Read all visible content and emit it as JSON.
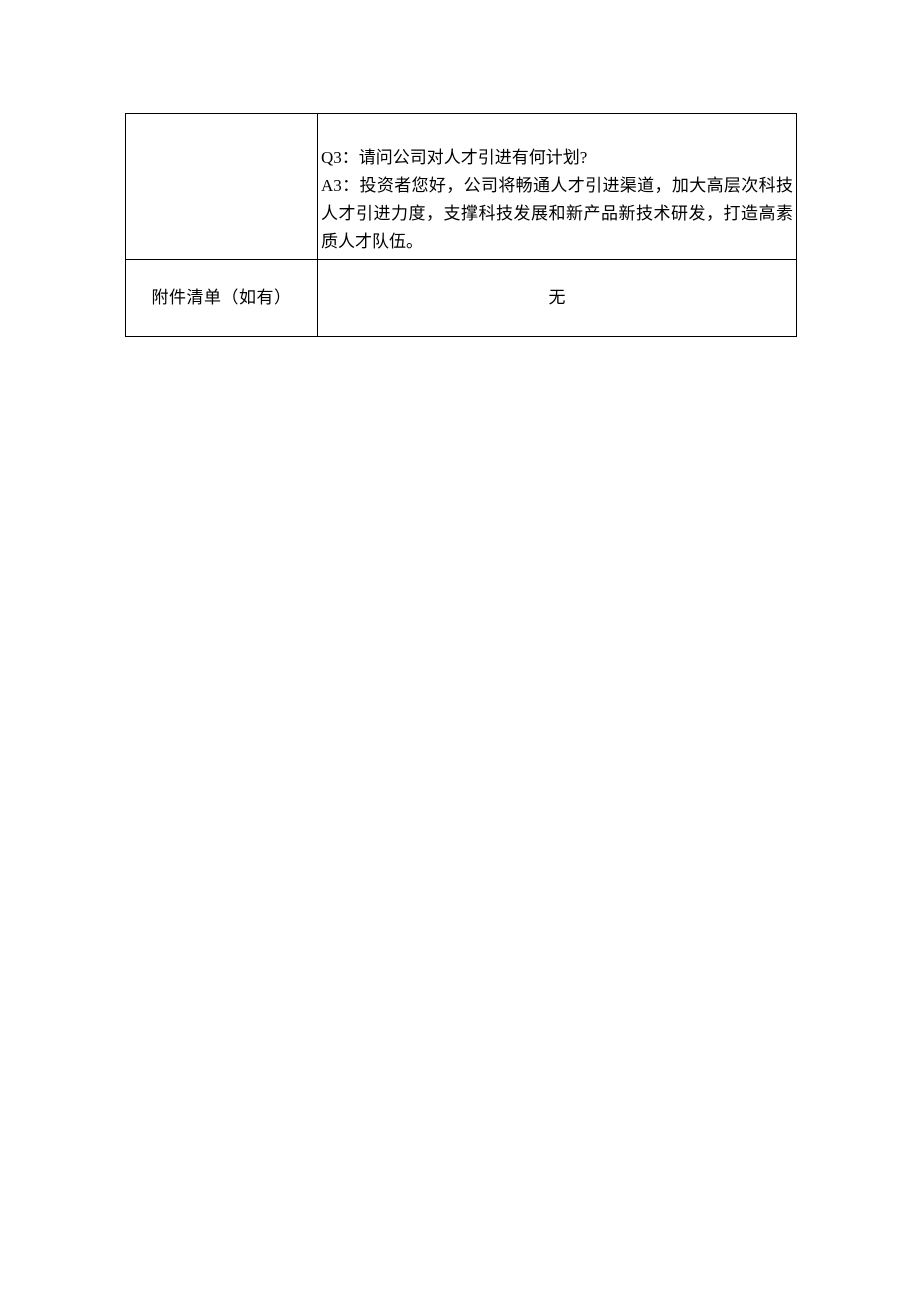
{
  "table": {
    "row1": {
      "left": "",
      "q3": "Q3：请问公司对人才引进有何计划?",
      "a3": "A3：投资者您好，公司将畅通人才引进渠道，加大高层次科技人才引进力度，支撑科技发展和新产品新技术研发，打造高素质人才队伍。"
    },
    "row2": {
      "left": "附件清单（如有）",
      "right": "无"
    }
  }
}
